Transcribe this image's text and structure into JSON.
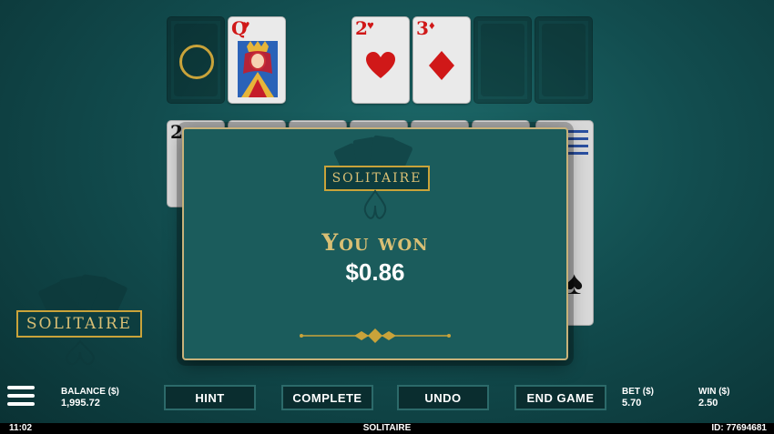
{
  "foundation": {
    "waste_card": {
      "rank": "Q",
      "suit": "hearts"
    },
    "piles": [
      {
        "rank": "2",
        "suit": "hearts"
      },
      {
        "rank": "3",
        "suit": "diamonds"
      }
    ]
  },
  "tableau_peek": {
    "card_rank": "2"
  },
  "background_logo": {
    "text": "SOLITAIRE"
  },
  "modal": {
    "logo_text": "SOLITAIRE",
    "headline": "You won",
    "amount": "$0.86"
  },
  "controls": {
    "hint": "HINT",
    "complete": "COMPLETE",
    "undo": "UNDO",
    "end_game": "END GAME"
  },
  "stats": {
    "balance_label": "BALANCE ($)",
    "balance_value": "1,995.72",
    "bet_label": "BET ($)",
    "bet_value": "5.70",
    "win_label": "WIN ($)",
    "win_value": "2.50"
  },
  "status_bar": {
    "time": "11:02",
    "title": "SOLITAIRE",
    "id": "ID: 77694681"
  },
  "colors": {
    "felt": "#124d4f",
    "gold": "#c9a33a",
    "red_suit": "#d01818"
  }
}
